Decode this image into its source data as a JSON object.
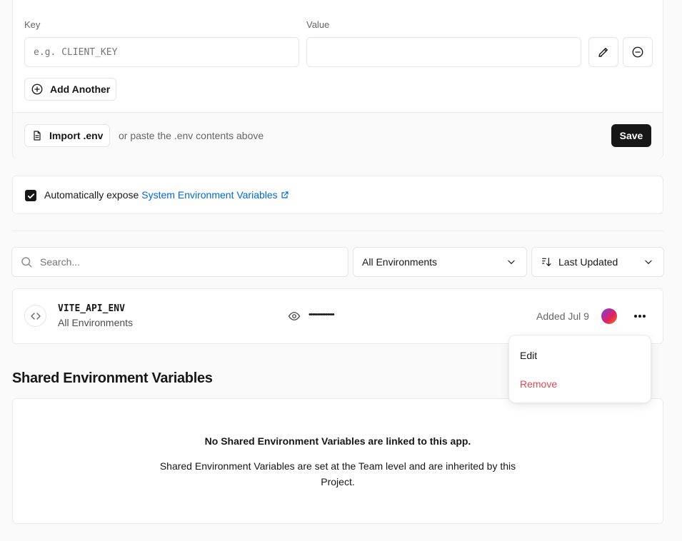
{
  "form": {
    "key_label": "Key",
    "value_label": "Value",
    "key_placeholder": "e.g. CLIENT_KEY",
    "value_value": "",
    "add_another_label": "Add Another",
    "import_label": "Import .env",
    "paste_hint": "or paste the .env contents above",
    "save_label": "Save"
  },
  "system_vars": {
    "checked": true,
    "prefix": "Automatically expose",
    "link_label": "System Environment Variables"
  },
  "filters": {
    "search_placeholder": "Search...",
    "environment_selected": "All Environments",
    "sort_selected": "Last Updated"
  },
  "variables": [
    {
      "name": "VITE_API_ENV",
      "environment": "All Environments",
      "masked_value": "•••••••••••••••",
      "added": "Added Jul 9"
    }
  ],
  "context_menu": {
    "edit_label": "Edit",
    "remove_label": "Remove"
  },
  "shared": {
    "heading": "Shared Environment Variables",
    "empty_title": "No Shared Environment Variables are linked to this app.",
    "empty_body": "Shared Environment Variables are set at the Team level and are inherited by this Project."
  },
  "colors": {
    "link": "#0068d6",
    "danger": "#e5484d",
    "primary": "#171717"
  }
}
